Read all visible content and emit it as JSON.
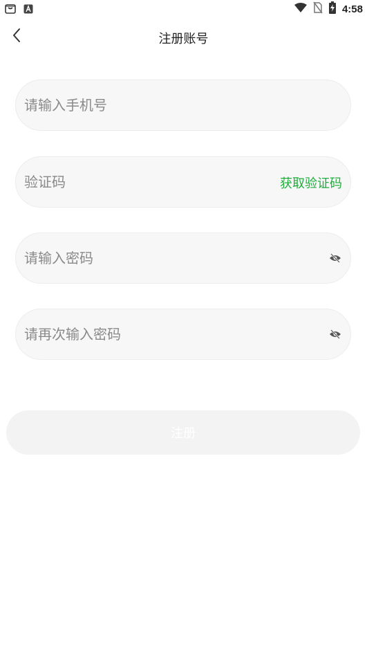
{
  "status_bar": {
    "time": "4:58",
    "left_icons": [
      "shopping-bag-icon",
      "a-letter-icon"
    ],
    "right_icons": [
      "wifi-icon",
      "no-sim-icon",
      "battery-charging-icon"
    ]
  },
  "header": {
    "title": "注册账号",
    "back_icon": "chevron-left-icon"
  },
  "form": {
    "phone_placeholder": "请输入手机号",
    "code_placeholder": "验证码",
    "get_code_label": "获取验证码",
    "password_placeholder": "请输入密码",
    "confirm_password_placeholder": "请再次输入密码",
    "submit_label": "注册"
  },
  "colors": {
    "accent_green": "#1fae3c",
    "field_background": "#f7f7f7",
    "button_disabled": "#f3f3f3"
  }
}
